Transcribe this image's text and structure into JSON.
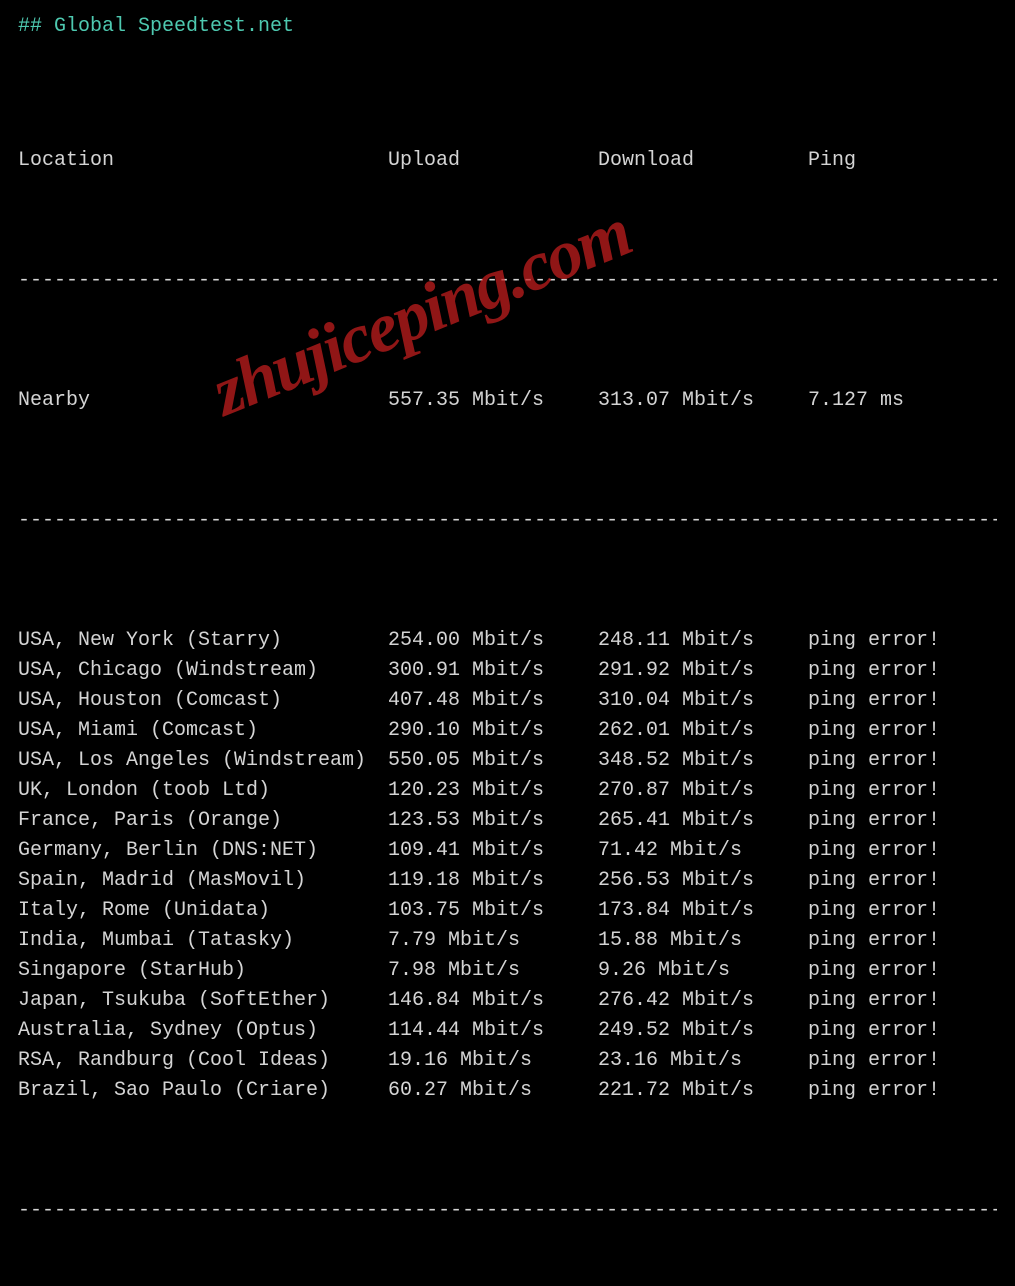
{
  "title": "## Global Speedtest.net",
  "header": {
    "location": "Location",
    "upload": "Upload",
    "download": "Download",
    "ping": "Ping"
  },
  "divider": "----------------------------------------------------------------------------------",
  "nearby": {
    "location": "Nearby",
    "upload": "557.35 Mbit/s",
    "download": "313.07 Mbit/s",
    "ping": "7.127 ms"
  },
  "rows": [
    {
      "location": "USA, New York (Starry)",
      "upload": "254.00 Mbit/s",
      "download": "248.11 Mbit/s",
      "ping": "ping error!"
    },
    {
      "location": "USA, Chicago (Windstream)",
      "upload": "300.91 Mbit/s",
      "download": "291.92 Mbit/s",
      "ping": "ping error!"
    },
    {
      "location": "USA, Houston (Comcast)",
      "upload": "407.48 Mbit/s",
      "download": "310.04 Mbit/s",
      "ping": "ping error!"
    },
    {
      "location": "USA, Miami (Comcast)",
      "upload": "290.10 Mbit/s",
      "download": "262.01 Mbit/s",
      "ping": "ping error!"
    },
    {
      "location": "USA, Los Angeles (Windstream)",
      "upload": "550.05 Mbit/s",
      "download": "348.52 Mbit/s",
      "ping": "ping error!"
    },
    {
      "location": "UK, London (toob Ltd)",
      "upload": "120.23 Mbit/s",
      "download": "270.87 Mbit/s",
      "ping": "ping error!"
    },
    {
      "location": "France, Paris (Orange)",
      "upload": "123.53 Mbit/s",
      "download": "265.41 Mbit/s",
      "ping": "ping error!"
    },
    {
      "location": "Germany, Berlin (DNS:NET)",
      "upload": "109.41 Mbit/s",
      "download": "71.42 Mbit/s",
      "ping": "ping error!"
    },
    {
      "location": "Spain, Madrid (MasMovil)",
      "upload": "119.18 Mbit/s",
      "download": "256.53 Mbit/s",
      "ping": "ping error!"
    },
    {
      "location": "Italy, Rome (Unidata)",
      "upload": "103.75 Mbit/s",
      "download": "173.84 Mbit/s",
      "ping": "ping error!"
    },
    {
      "location": "India, Mumbai (Tatasky)",
      "upload": "7.79 Mbit/s",
      "download": "15.88 Mbit/s",
      "ping": "ping error!"
    },
    {
      "location": "Singapore (StarHub)",
      "upload": "7.98 Mbit/s",
      "download": "9.26 Mbit/s",
      "ping": "ping error!"
    },
    {
      "location": "Japan, Tsukuba (SoftEther)",
      "upload": "146.84 Mbit/s",
      "download": "276.42 Mbit/s",
      "ping": "ping error!"
    },
    {
      "location": "Australia, Sydney (Optus)",
      "upload": "114.44 Mbit/s",
      "download": "249.52 Mbit/s",
      "ping": "ping error!"
    },
    {
      "location": "RSA, Randburg (Cool Ideas)",
      "upload": "19.16 Mbit/s",
      "download": "23.16 Mbit/s",
      "ping": "ping error!"
    },
    {
      "location": "Brazil, Sao Paulo (Criare)",
      "upload": "60.27 Mbit/s",
      "download": "221.72 Mbit/s",
      "ping": "ping error!"
    }
  ],
  "watermark": "zhujiceping.com"
}
